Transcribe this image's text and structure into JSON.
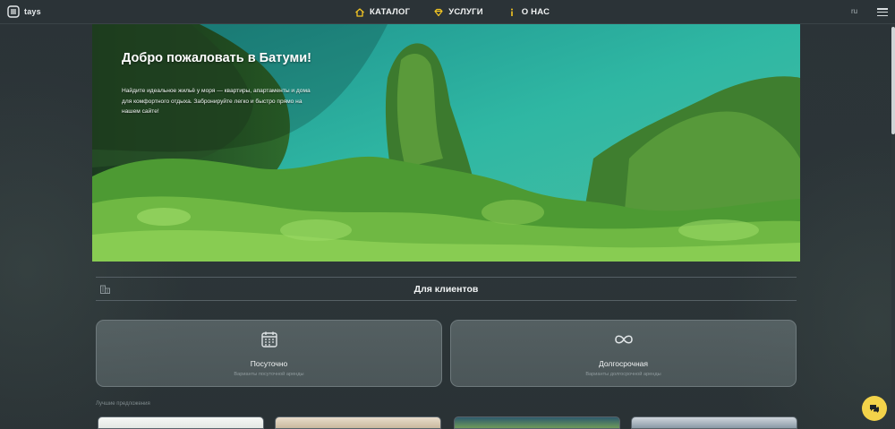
{
  "header": {
    "logo_text": "tays",
    "nav": [
      {
        "label": "КАТАЛОГ",
        "icon": "home-icon"
      },
      {
        "label": "УСЛУГИ",
        "icon": "diamond-icon"
      },
      {
        "label": "О НАС",
        "icon": "info-icon"
      }
    ],
    "language": "ru",
    "accent_color": "#f3c623"
  },
  "hero": {
    "title": "Добро пожаловать в Батуми!",
    "text": "Найдите идеальное жильё у моря — квартиры, апартаменты и дома для комфортного отдыха. Забронируйте легко и быстро прямо на нашем сайте!"
  },
  "clients": {
    "title": "Для клиентов",
    "cards": [
      {
        "title": "Посуточно",
        "subtitle": "Варианты посуточной аренды",
        "icon": "calendar-icon"
      },
      {
        "title": "Долгосрочная",
        "subtitle": "Варианты долгосрочной аренды",
        "icon": "infinity-icon"
      }
    ]
  },
  "best_offers_label": "Лучшие предложения"
}
